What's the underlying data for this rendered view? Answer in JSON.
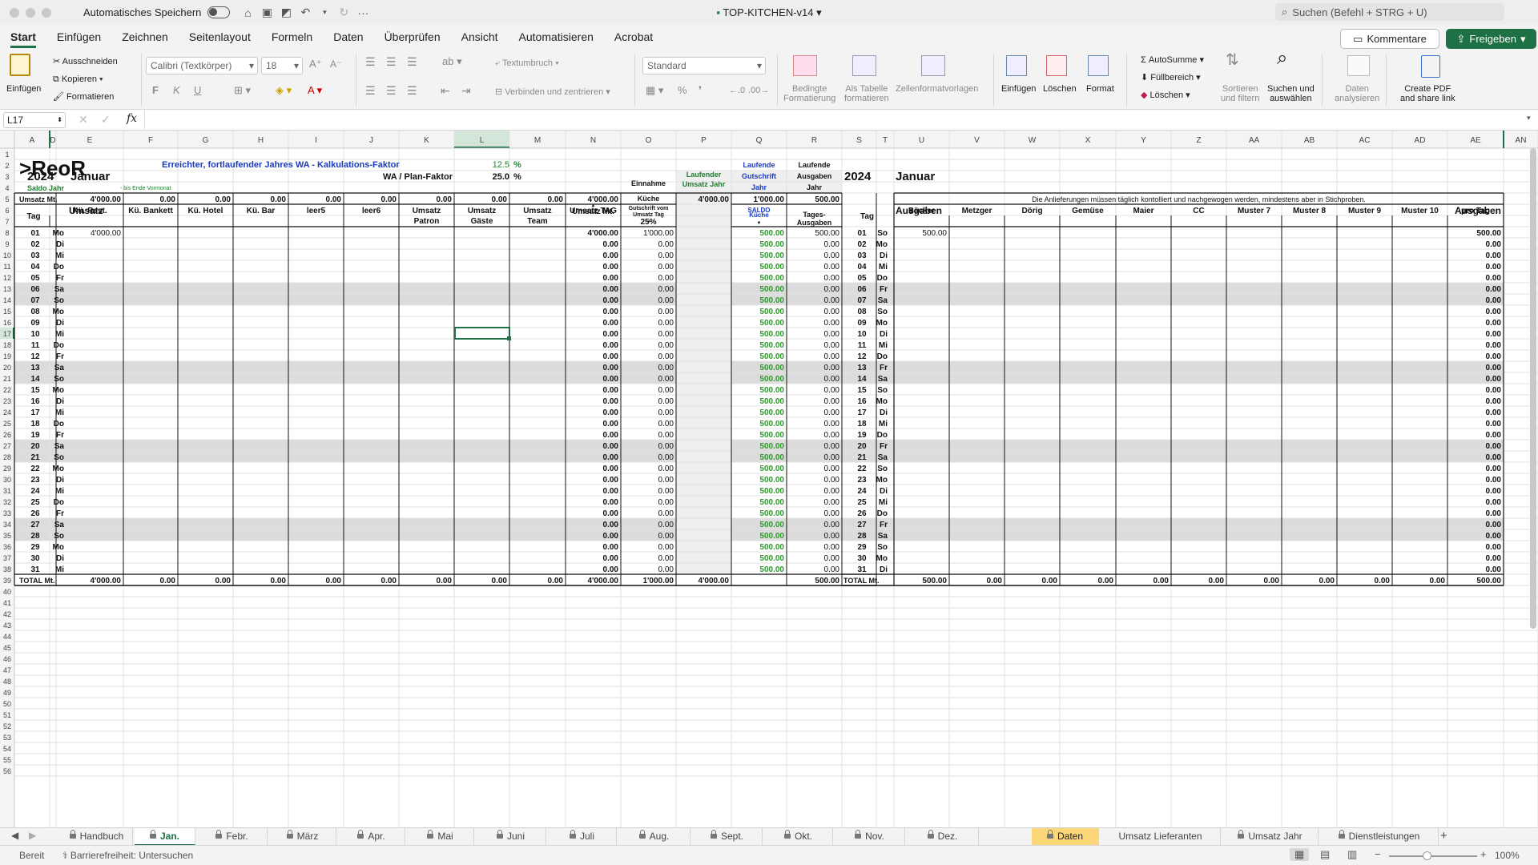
{
  "titlebar": {
    "autosave": "Automatisches Speichern",
    "title": "TOP-KITCHEN-v14",
    "search": "Suchen (Befehl + STRG + U)"
  },
  "menu": [
    "Start",
    "Einfügen",
    "Zeichnen",
    "Seitenlayout",
    "Formeln",
    "Daten",
    "Überprüfen",
    "Ansicht",
    "Automatisieren",
    "Acrobat"
  ],
  "kommentare": "Kommentare",
  "freigeben": "Freigeben",
  "ribbon": {
    "einfuegen": "Einfügen",
    "ausschneiden": "Ausschneiden",
    "kopieren": "Kopieren",
    "formatieren": "Formatieren",
    "font": "Calibri (Textkörper)",
    "size": "18",
    "textumbruch": "Textumbruch",
    "verbinden": "Verbinden und zentrieren",
    "numfmt": "Standard",
    "bedingte": "Bedingte",
    "formatierung": "Formatierung",
    "als_tabelle": "Als Tabelle",
    "formatieren2": "formatieren",
    "zellformat": "Zellenformatvorlagen",
    "ins": "Einfügen",
    "loeschen": "Löschen",
    "format": "Format",
    "autosumme": "AutoSumme",
    "fuellbereich": "Füllbereich",
    "loeschen2": "Löschen",
    "sortieren": "Sortieren",
    "und_filtern": "und filtern",
    "suchen": "Suchen und",
    "auswaehlen": "auswählen",
    "daten": "Daten",
    "analysieren": "analysieren",
    "create_pdf": "Create PDF",
    "share_link": "and share link",
    "bold": "F",
    "italic": "K",
    "underline": "U"
  },
  "namebox": "L17",
  "fx": "fx",
  "columns": [
    "A",
    "D",
    "E",
    "F",
    "G",
    "H",
    "I",
    "J",
    "K",
    "L",
    "M",
    "N",
    "O",
    "P",
    "Q",
    "R",
    "S",
    "T",
    "U",
    "V",
    "W",
    "X",
    "Y",
    "Z",
    "AA",
    "AB",
    "AC",
    "AD",
    "AE",
    "AN"
  ],
  "sheet": {
    "logo": ">ReoR",
    "year": "2024",
    "month": "Januar",
    "wa_label": "Erreichter, fortlaufender Jahres WA - Kalkulations-Faktor",
    "wa_value": "12.5",
    "pct": "%",
    "plan_label": "WA / Plan-Faktor",
    "plan_value": "25.0",
    "saldo_jahr": "Saldo Jahr",
    "bis_ende": "- bis Ende Vormonat",
    "umsatz_mt": "Umsatz Mt.",
    "row5": [
      "4'000.00",
      "0.00",
      "0.00",
      "0.00",
      "0.00",
      "0.00",
      "0.00",
      "0.00",
      "4'000.00"
    ],
    "einnahme": "Einnahme",
    "kueche": "Küche",
    "laufender": "Laufender",
    "umsatz_jahr": "Umsatz  Jahr",
    "laufend_umsatz": "4'000.00",
    "laufende": "Laufende",
    "gutschrift": "Gutschrift",
    "jahr": "Jahr",
    "gutschrift_val": "1'000.00",
    "ausgaben_jahr": "Ausgaben",
    "ausgaben_val": "500.00",
    "year2": "2024",
    "month2": "Januar",
    "notice": "Die Anlieferungen müssen täglich kontolliert und nachgewogen werden, mindestens aber in Stichproben.",
    "umsatz": "Umsatz",
    "ausgaben": "Ausgaben",
    "tag": "Tag",
    "umsatz_mt2": "Umsatz Mt.",
    "gutschrift_vom": "Gutschrift vom",
    "umsatz_tag_small": "Umsatz Tag",
    "pct25": "25%",
    "saldo": "SALDO",
    "saldo_kueche": "Küche",
    "tages": "Tages-",
    "ausgaben2": "Ausgaben",
    "left_headers": [
      "Kü. Rest.",
      "Kü. Bankett",
      "Kü. Hotel",
      "Kü. Bar",
      "leer5",
      "leer6",
      "Umsatz Patron",
      "Umsatz Gäste",
      "Umsatz Team",
      "Umsatz TAG"
    ],
    "right_headers": [
      "Bäcker",
      "Metzger",
      "Dörig",
      "Gemüse",
      "Maier",
      "CC",
      "Muster 7",
      "Muster 8",
      "Muster 9",
      "Muster 10",
      "pro Tag"
    ],
    "left_days": [
      "Mo",
      "Di",
      "Mi",
      "Do",
      "Fr",
      "Sa",
      "So",
      "Mo",
      "Di",
      "Mi",
      "Do",
      "Fr",
      "Sa",
      "So",
      "Mo",
      "Di",
      "Mi",
      "Do",
      "Fr",
      "Sa",
      "So",
      "Mo",
      "Di",
      "Mi",
      "Do",
      "Fr",
      "Sa",
      "So",
      "Mo",
      "Di",
      "Mi"
    ],
    "right_days": [
      "So",
      "Mo",
      "Di",
      "Mi",
      "Do",
      "Fr",
      "Sa",
      "So",
      "Mo",
      "Di",
      "Mi",
      "Do",
      "Fr",
      "Sa",
      "So",
      "Mo",
      "Di",
      "Mi",
      "Do",
      "Fr",
      "Sa",
      "So",
      "Mo",
      "Di",
      "Mi",
      "Do",
      "Fr",
      "Sa",
      "So",
      "Mo",
      "Di"
    ],
    "zero": "0.00",
    "saldo_val": "500.00",
    "first_row": {
      "e": "4'000.00",
      "n": "4'000.00",
      "o": "1'000.00",
      "u": "500.00",
      "ae": "500.00"
    },
    "total_label": "TOTAL Mt.",
    "total_left": [
      "4'000.00",
      "0.00",
      "0.00",
      "0.00",
      "0.00",
      "0.00",
      "0.00",
      "0.00",
      "0.00",
      "4'000.00",
      "1'000.00",
      "4'000.00"
    ],
    "total_r": "500.00",
    "total_right": [
      "500.00",
      "0.00",
      "0.00",
      "0.00",
      "0.00",
      "0.00",
      "0.00",
      "0.00",
      "0.00",
      "0.00",
      "500.00"
    ]
  },
  "tabs": [
    "Handbuch",
    "Jan.",
    "Febr.",
    "März",
    "Apr.",
    "Mai",
    "Juni",
    "Juli",
    "Aug.",
    "Sept.",
    "Okt.",
    "Nov.",
    "Dez.",
    "Daten",
    "Umsatz Lieferanten",
    "Umsatz Jahr",
    "Dienstleistungen"
  ],
  "status": {
    "bereit": "Bereit",
    "barriere": "Barrierefreiheit: Untersuchen",
    "zoom": "100%"
  }
}
